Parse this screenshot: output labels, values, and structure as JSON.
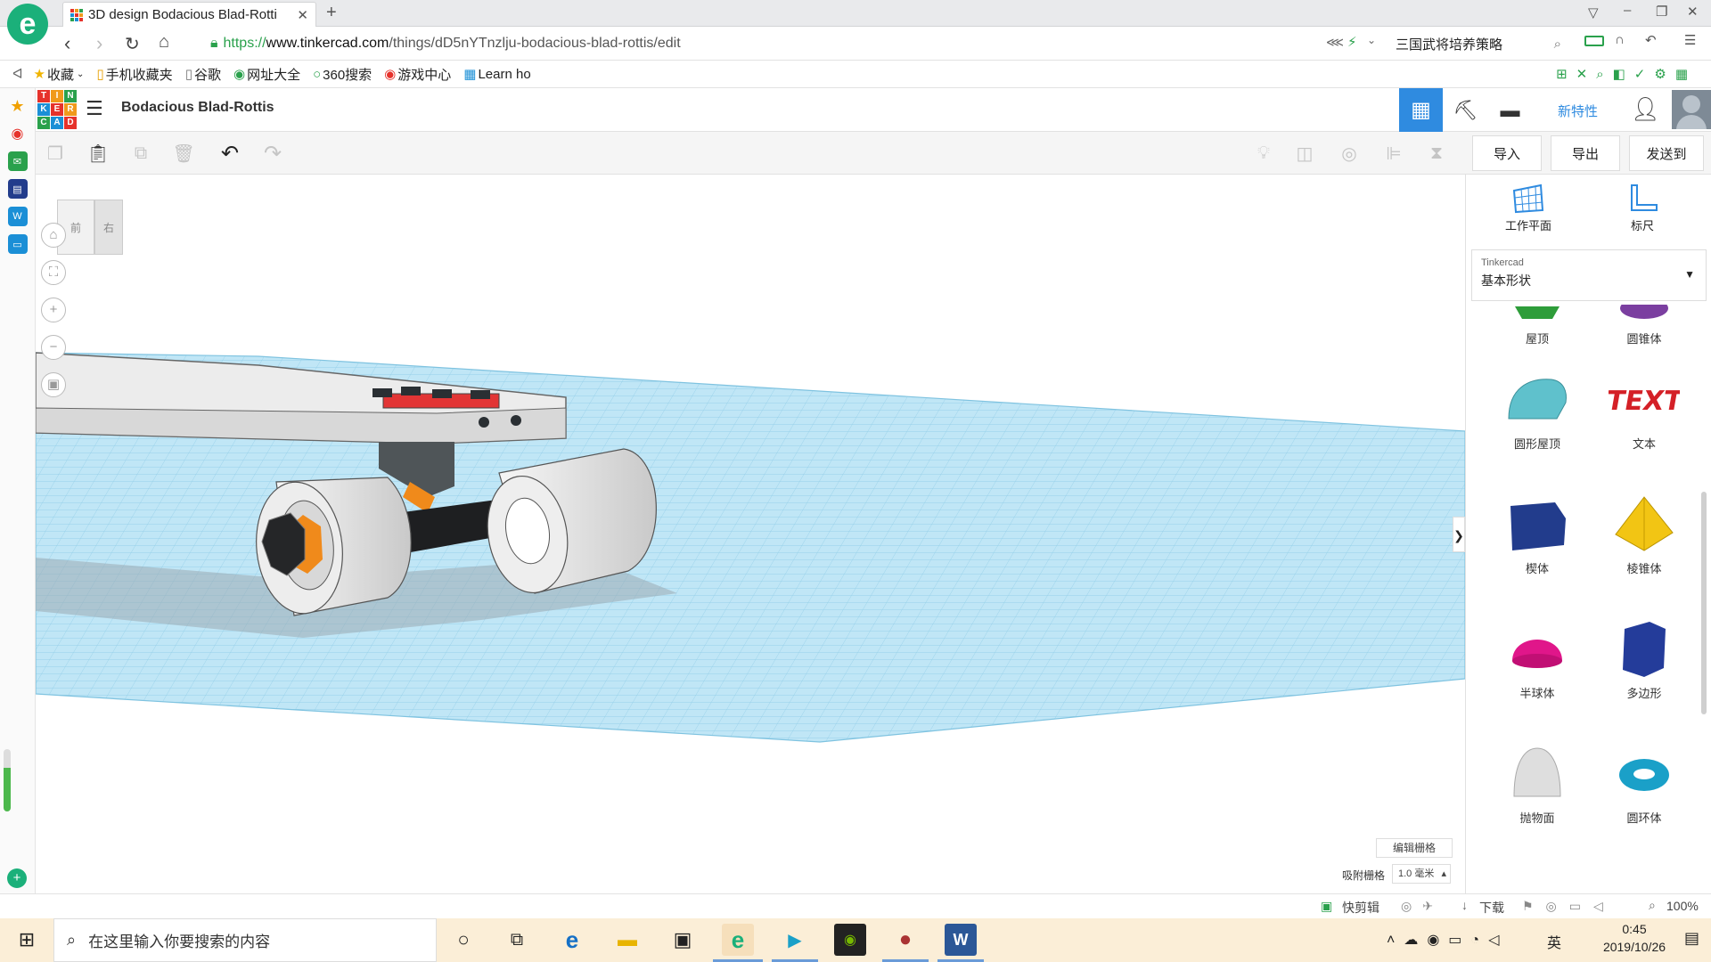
{
  "browser": {
    "tab_title": "3D design Bodacious Blad-Rotti",
    "url_scheme": "https://",
    "url_host": "www.tinkercad.com",
    "url_path": "/things/dD5nYTnzlju-bodacious-blad-rottis/edit",
    "search_text": "三国武将培养策略",
    "bookmarks": [
      "收藏",
      "手机收藏夹",
      "谷歌",
      "网址大全",
      "360搜索",
      "游戏中心",
      "Learn ho"
    ]
  },
  "app": {
    "logo_rows": [
      "TIN",
      "KER",
      "CAD"
    ],
    "design_title": "Bodacious Blad-Rottis",
    "new_features": "新特性",
    "import_label": "导入",
    "export_label": "导出",
    "send_label": "发送到"
  },
  "viewcube": {
    "front": "前",
    "right": "右"
  },
  "panel": {
    "workplane_label": "工作平面",
    "ruler_label": "标尺",
    "library_source": "Tinkercad",
    "library_category": "基本形状",
    "shapes": [
      {
        "label": "屋顶",
        "icon": "roof-icon",
        "color": "#2e9d3a"
      },
      {
        "label": "圆锥体",
        "icon": "cone-icon",
        "color": "#7b3fa0"
      },
      {
        "label": "圆形屋顶",
        "icon": "round-roof-icon",
        "color": "#5fc1cc"
      },
      {
        "label": "文本",
        "icon": "text-icon",
        "color": "#d42027"
      },
      {
        "label": "楔体",
        "icon": "wedge-icon",
        "color": "#223c8c"
      },
      {
        "label": "棱锥体",
        "icon": "pyramid-icon",
        "color": "#f2c514"
      },
      {
        "label": "半球体",
        "icon": "half-sphere-icon",
        "color": "#e0168a"
      },
      {
        "label": "多边形",
        "icon": "polygon-icon",
        "color": "#243c9a"
      },
      {
        "label": "抛物面",
        "icon": "paraboloid-icon",
        "color": "#cfcfcf"
      },
      {
        "label": "圆环体",
        "icon": "torus-icon",
        "color": "#1aa0c8"
      }
    ]
  },
  "grid": {
    "edit_grid": "编辑栅格",
    "snap_label": "吸附栅格",
    "snap_value": "1.0 毫米"
  },
  "statusbar": {
    "quick_clip": "快剪辑",
    "download": "下载",
    "zoom": "100%"
  },
  "taskbar": {
    "search_placeholder": "在这里输入你要搜索的内容",
    "lang": "英",
    "time": "0:45",
    "date": "2019/10/26"
  }
}
